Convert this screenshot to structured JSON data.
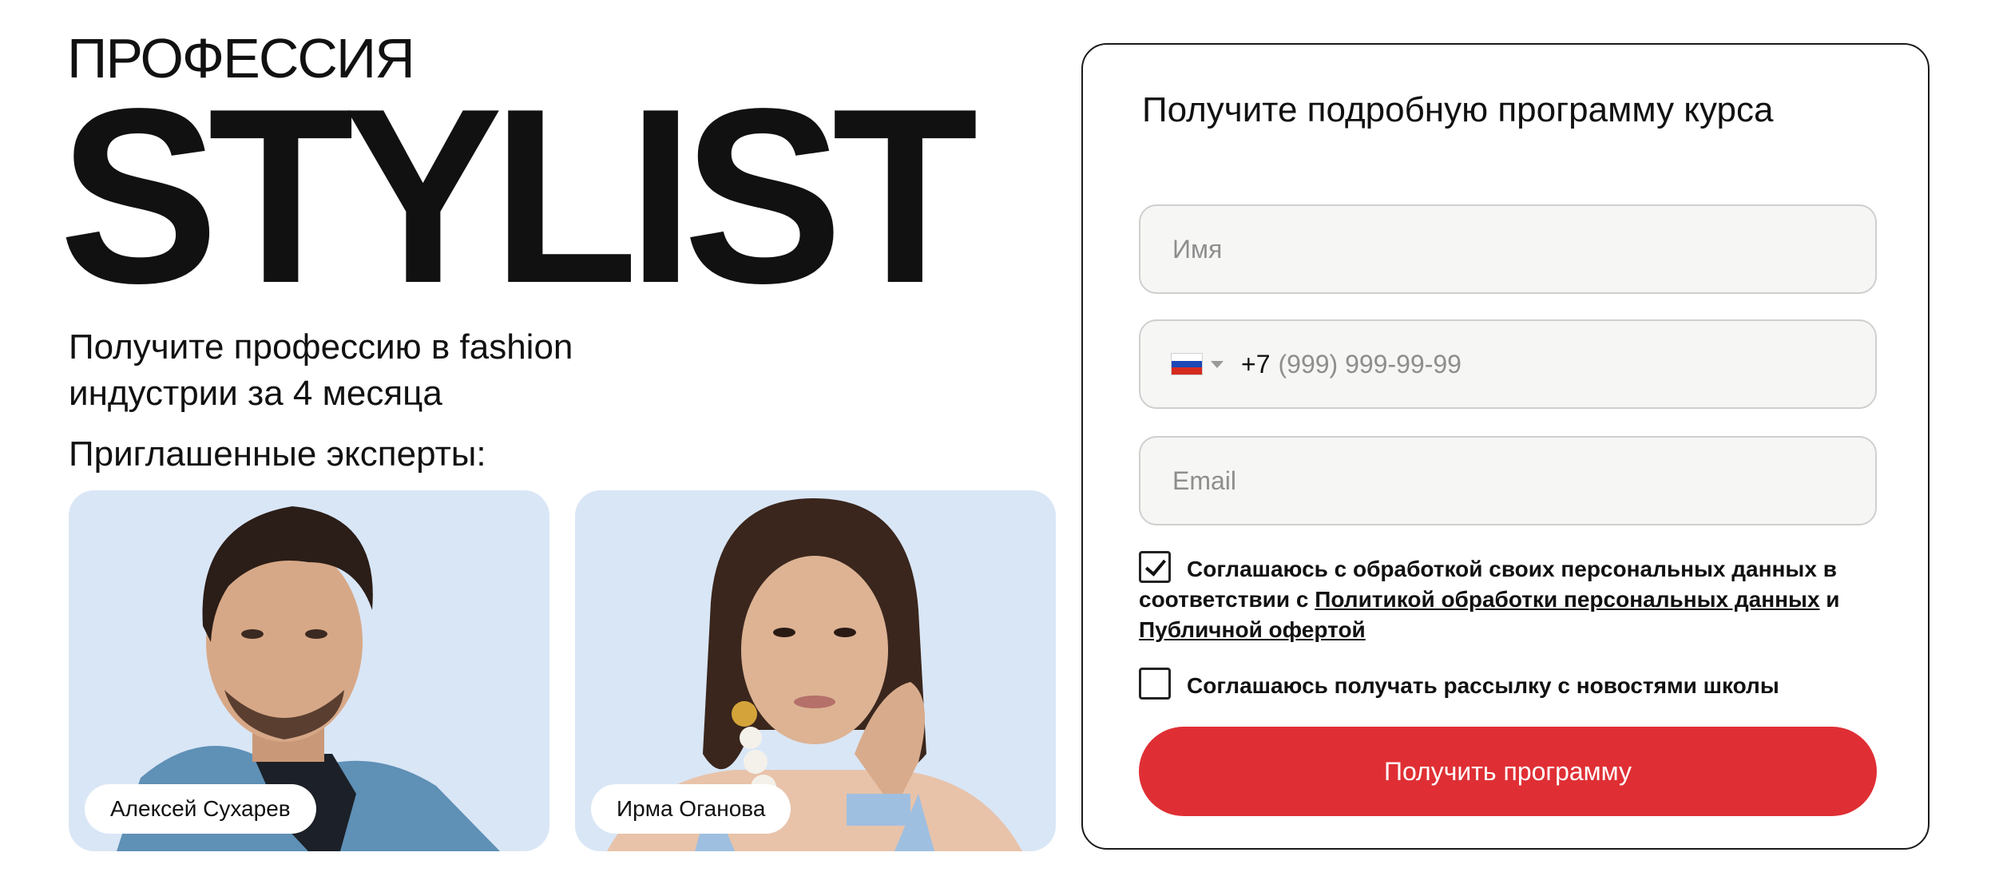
{
  "hero": {
    "eyebrow": "ПРОФЕССИЯ",
    "title": "STYLIST",
    "subtitle_line1": "Получите профессию в fashion",
    "subtitle_line2": "индустрии за 4 месяца",
    "experts_heading": "Приглашенные эксперты:"
  },
  "experts": [
    {
      "name": "Алексей Сухарев"
    },
    {
      "name": "Ирма Оганова"
    }
  ],
  "form": {
    "title": "Получите подробную программу курса",
    "name_placeholder": "Имя",
    "phone_country": "ru-flag-icon",
    "phone_dial_code": "+7",
    "phone_placeholder": "(999) 999-99-99",
    "email_placeholder": "Email",
    "consent_personal": {
      "checked": true,
      "text_before": "Соглашаюсь с обработкой своих персональных данных в соответствии с ",
      "policy_link": "Политикой обработки персональных данных",
      "text_middle": " и ",
      "offer_link": "Публичной офертой"
    },
    "consent_newsletter": {
      "checked": false,
      "text": "Соглашаюсь получать рассылку с новостями школы"
    },
    "submit_label": "Получить программу"
  },
  "colors": {
    "accent": "#df2f34",
    "card_background": "#d9e6f6",
    "field_background": "#f6f6f4"
  }
}
